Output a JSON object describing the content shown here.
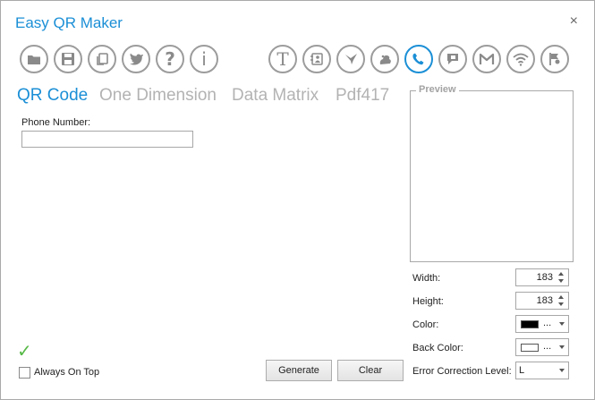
{
  "window": {
    "title": "Easy QR Maker",
    "close_glyph": "×"
  },
  "toolbar": {
    "left": [
      {
        "id": "open",
        "icon": "folder-icon"
      },
      {
        "id": "save",
        "icon": "floppy-disk-icon"
      },
      {
        "id": "copy",
        "icon": "copy-clipboard-icon"
      },
      {
        "id": "twitter",
        "icon": "twitter-bird-icon"
      },
      {
        "id": "help",
        "icon": "question-icon",
        "glyph": "?"
      },
      {
        "id": "info",
        "icon": "info-icon",
        "glyph": "i"
      }
    ],
    "right": [
      {
        "id": "text",
        "icon": "text-t-icon",
        "glyph": "T"
      },
      {
        "id": "contact",
        "icon": "contact-card-icon"
      },
      {
        "id": "email",
        "icon": "envelope-bird-icon"
      },
      {
        "id": "sms",
        "icon": "sms-message-icon"
      },
      {
        "id": "phone",
        "icon": "phone-icon",
        "active": true
      },
      {
        "id": "mms",
        "icon": "mms-bubble-icon"
      },
      {
        "id": "gmail",
        "icon": "gmail-m-icon"
      },
      {
        "id": "wifi",
        "icon": "wifi-icon"
      },
      {
        "id": "geo",
        "icon": "location-flag-icon"
      }
    ]
  },
  "tabs": [
    {
      "label": "QR Code",
      "active": true
    },
    {
      "label": "One Dimension",
      "active": false
    },
    {
      "label": "Data Matrix",
      "active": false
    },
    {
      "label": "Pdf417",
      "active": false
    }
  ],
  "form": {
    "phone_label": "Phone Number:",
    "phone_value": ""
  },
  "preview": {
    "legend": "Preview"
  },
  "options": {
    "width_label": "Width:",
    "width_value": "183",
    "height_label": "Height:",
    "height_value": "183",
    "color_label": "Color:",
    "color_swatch": "#000000",
    "color_dots": "...",
    "back_color_label": "Back Color:",
    "back_color_swatch": "#ffffff",
    "back_color_dots": "...",
    "ecl_label": "Error Correction Level:",
    "ecl_value": "L"
  },
  "footer": {
    "always_on_top_label": "Always On Top",
    "always_on_top_checked": false,
    "generate_label": "Generate",
    "clear_label": "Clear"
  },
  "colors": {
    "accent": "#1b8fd6",
    "icon_gray": "#8a8a8a",
    "success": "#57b947"
  }
}
